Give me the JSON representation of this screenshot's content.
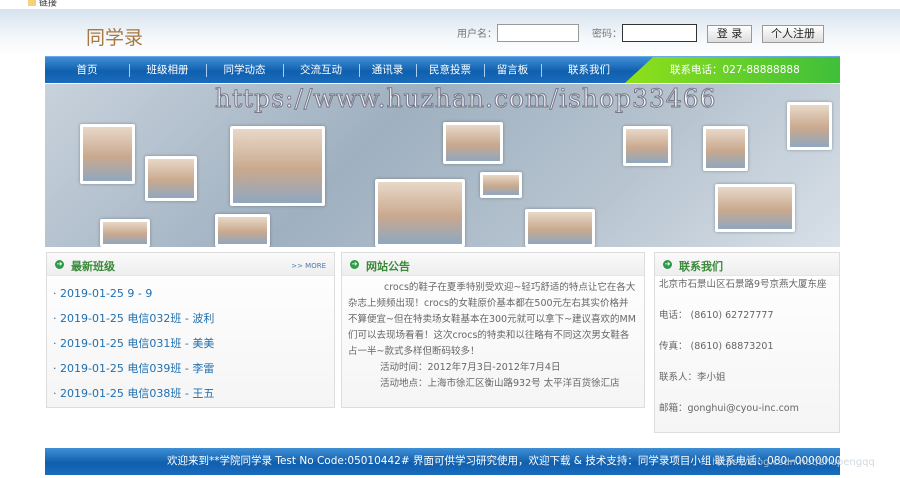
{
  "topbar": {
    "bookmark_label": "链接"
  },
  "header": {
    "logo": "同学录",
    "username_label": "用户名：",
    "password_label": "密码：",
    "username_value": "",
    "password_value": "",
    "login_button": "登 录",
    "register_button": "个人注册"
  },
  "nav": {
    "items": [
      "首页",
      "班级相册",
      "同学动态",
      "交流互动",
      "通讯录",
      "民意投票",
      "留言板",
      "联系我们"
    ],
    "phone": "联系电话：027-88888888"
  },
  "banner": {
    "watermark": "https://www.huzhan.com/ishop33466"
  },
  "latest_classes": {
    "title": "最新班级",
    "more": ">> MORE",
    "items": [
      "· 2019-01-25 9 - 9",
      "· 2019-01-25 电信032班 - 波利",
      "· 2019-01-25 电信031班 - 美美",
      "· 2019-01-25 电信039班 - 李雷",
      "· 2019-01-25 电信038班 - 王五"
    ]
  },
  "notice": {
    "title": "网站公告",
    "body": "crocs的鞋子在夏季特别受欢迎~轻巧舒适的特点让它在各大杂志上频频出现！crocs的女鞋原价基本都在500元左右其实价格并不算便宜~但在特卖场女鞋基本在300元就可以拿下~建议喜欢的MM们可以去现场看看！这次crocs的特卖和以往略有不同这次男女鞋各占一半~款式多样但断码较多！",
    "time": "活动时间：2012年7月3日-2012年7月4日",
    "place": "活动地点：上海市徐汇区衡山路932号 太平洋百货徐汇店"
  },
  "contact": {
    "title": "联系我们",
    "address": "北京市石景山区石景路9号京燕大厦东座",
    "phone": "电话： (8610) 62727777",
    "fax": "传真： (8610) 68873201",
    "person": "联系人：李小姐",
    "email": "邮箱：gonghui@cyou-inc.com"
  },
  "footer": {
    "text": "欢迎来到**学院同学录  Test No  Code:05010442# 界面可供学习研究使用，欢迎下载 & 技术支持：同学录项目小组   联系电话：080--00000000",
    "csdn_watermark": "https://blog.csdn.net/zhupengqq"
  }
}
